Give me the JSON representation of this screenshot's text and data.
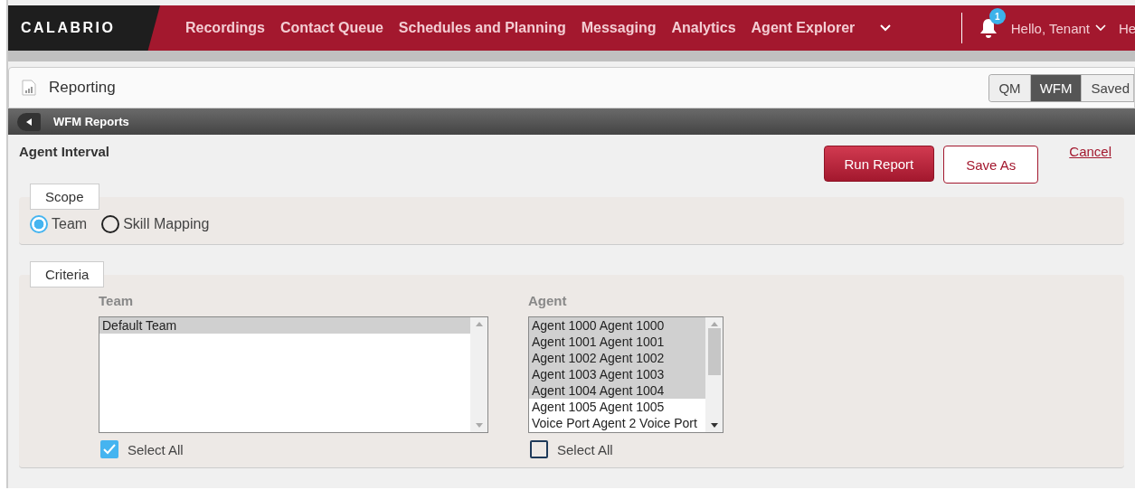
{
  "nav": {
    "logo": "CALABRIO",
    "items": [
      "Recordings",
      "Contact Queue",
      "Schedules and Planning",
      "Messaging",
      "Analytics",
      "Agent Explorer"
    ],
    "notification_count": "1",
    "user": "Hello, Tenant",
    "extra": "He"
  },
  "header": {
    "title": "Reporting",
    "tabs": [
      {
        "label": "QM",
        "selected": false
      },
      {
        "label": "WFM",
        "selected": true
      },
      {
        "label": "Saved",
        "selected": false
      }
    ]
  },
  "breadcrumb": "WFM Reports",
  "report": {
    "title": "Agent Interval",
    "buttons": {
      "run": "Run Report",
      "save": "Save As",
      "cancel": "Cancel"
    }
  },
  "scope": {
    "legend": "Scope",
    "options": [
      {
        "label": "Team",
        "selected": true
      },
      {
        "label": "Skill Mapping",
        "selected": false
      }
    ]
  },
  "criteria": {
    "legend": "Criteria",
    "lists": [
      {
        "label": "Team",
        "items": [
          {
            "label": "Default Team",
            "selected": true
          }
        ],
        "select_all": {
          "label": "Select All",
          "checked": true
        }
      },
      {
        "label": "Agent",
        "items": [
          {
            "label": "Agent 1000 Agent 1000",
            "selected": true
          },
          {
            "label": "Agent 1001 Agent 1001",
            "selected": true
          },
          {
            "label": "Agent 1002 Agent 1002",
            "selected": true
          },
          {
            "label": "Agent 1003 Agent 1003",
            "selected": true
          },
          {
            "label": "Agent 1004 Agent 1004",
            "selected": true
          },
          {
            "label": "Agent 1005 Agent 1005",
            "selected": false
          },
          {
            "label": "Voice Port Agent 2 Voice Port",
            "selected": false
          }
        ],
        "select_all": {
          "label": "Select All",
          "checked": false
        }
      }
    ]
  }
}
